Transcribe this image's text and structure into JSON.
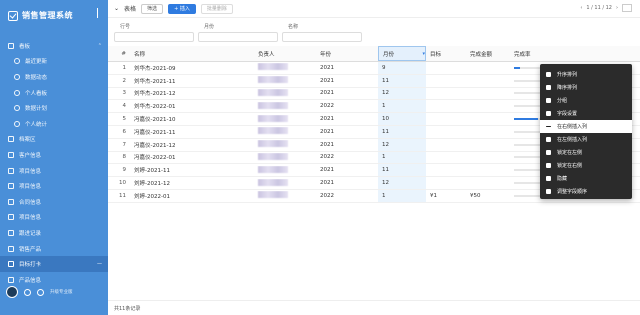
{
  "sidebar": {
    "title": "销售管理系统",
    "items": [
      {
        "label": "看板",
        "kind": "group",
        "active": false
      },
      {
        "label": "最近更新",
        "kind": "sub",
        "active": false
      },
      {
        "label": "数据动态",
        "kind": "sub",
        "active": false
      },
      {
        "label": "个人看板",
        "kind": "sub",
        "active": false
      },
      {
        "label": "数据计划",
        "kind": "sub",
        "active": false
      },
      {
        "label": "个人统计",
        "kind": "sub",
        "active": false
      },
      {
        "label": "档案区",
        "kind": "top",
        "active": false
      },
      {
        "label": "客户信息",
        "kind": "top",
        "active": false
      },
      {
        "label": "项目信息",
        "kind": "top",
        "active": false
      },
      {
        "label": "项目信息",
        "kind": "top",
        "active": false
      },
      {
        "label": "合同信息",
        "kind": "top",
        "active": false
      },
      {
        "label": "项目信息",
        "kind": "top",
        "active": false
      },
      {
        "label": "跟进记录",
        "kind": "top",
        "active": false
      },
      {
        "label": "销售产品",
        "kind": "top",
        "active": false
      },
      {
        "label": "目标打卡",
        "kind": "top",
        "active": true
      },
      {
        "label": "产品信息",
        "kind": "top",
        "active": false
      }
    ],
    "footer_text": "升级专业版"
  },
  "toolbar": {
    "title": "表格",
    "btn1": "筛选",
    "btn2": "+ 插入",
    "btn3": "批量删除",
    "pager": "1 / 11 / 12"
  },
  "filters": [
    {
      "label": "行号"
    },
    {
      "label": "月份"
    },
    {
      "label": "名称"
    }
  ],
  "table": {
    "headers": [
      "名称",
      "负责人",
      "年份",
      "月份",
      "目标",
      "完成金额",
      "完成率"
    ],
    "rows": [
      {
        "idx": "1",
        "name": "刘华杰-2021-09",
        "year": "2021",
        "month": "9",
        "target": "",
        "done": "",
        "rate": "20%",
        "rate_value": 0.2
      },
      {
        "idx": "2",
        "name": "刘华杰-2021-11",
        "year": "2021",
        "month": "11",
        "target": "",
        "done": "",
        "rate": "",
        "rate_value": 0
      },
      {
        "idx": "3",
        "name": "刘华杰-2021-12",
        "year": "2021",
        "month": "12",
        "target": "",
        "done": "",
        "rate": "",
        "rate_value": 0
      },
      {
        "idx": "4",
        "name": "刘华杰-2022-01",
        "year": "2022",
        "month": "1",
        "target": "",
        "done": "",
        "rate": "",
        "rate_value": 0
      },
      {
        "idx": "5",
        "name": "冯嘉仪-2021-10",
        "year": "2021",
        "month": "10",
        "target": "",
        "done": "",
        "rate": "85%",
        "rate_value": 0.85
      },
      {
        "idx": "6",
        "name": "冯嘉仪-2021-11",
        "year": "2021",
        "month": "11",
        "target": "",
        "done": "",
        "rate": "",
        "rate_value": 0
      },
      {
        "idx": "7",
        "name": "冯嘉仪-2021-12",
        "year": "2021",
        "month": "12",
        "target": "",
        "done": "",
        "rate": "",
        "rate_value": 0
      },
      {
        "idx": "8",
        "name": "冯嘉仪-2022-01",
        "year": "2022",
        "month": "1",
        "target": "",
        "done": "",
        "rate": "",
        "rate_value": 0
      },
      {
        "idx": "9",
        "name": "刘婷-2021-11",
        "year": "2021",
        "month": "11",
        "target": "",
        "done": "",
        "rate": "",
        "rate_value": 0
      },
      {
        "idx": "10",
        "name": "刘婷-2021-12",
        "year": "2021",
        "month": "12",
        "target": "",
        "done": "",
        "rate": "",
        "rate_value": 0
      },
      {
        "idx": "11",
        "name": "刘婷-2022-01",
        "year": "2022",
        "month": "1",
        "target": "¥1",
        "done": "¥50",
        "rate": "",
        "rate_value": 0
      }
    ]
  },
  "context_menu": {
    "items": [
      {
        "label": "升序排列",
        "highlight": false
      },
      {
        "label": "降序排列",
        "highlight": false
      },
      {
        "label": "分组",
        "highlight": false
      },
      {
        "label": "字段设置",
        "highlight": false
      },
      {
        "label": "在右侧插入列",
        "highlight": true
      },
      {
        "label": "在左侧插入列",
        "highlight": false
      },
      {
        "label": "锁定在左侧",
        "highlight": false
      },
      {
        "label": "锁定在右侧",
        "highlight": false
      },
      {
        "label": "隐藏",
        "highlight": false
      },
      {
        "label": "调整字段顺序",
        "highlight": false
      }
    ]
  },
  "status": {
    "text": "共11条记录"
  }
}
